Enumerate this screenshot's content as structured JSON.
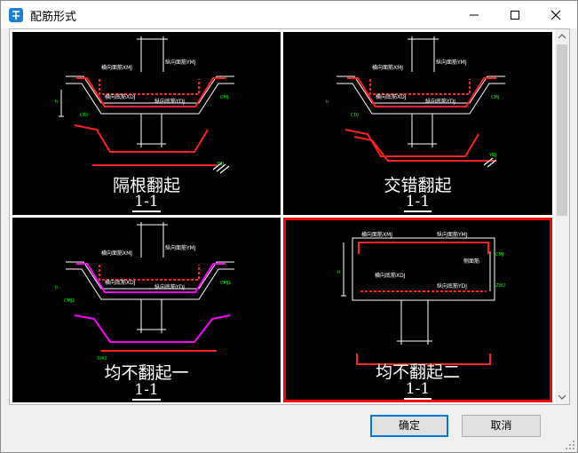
{
  "window": {
    "title": "配筋形式",
    "icons": {
      "app": "app-icon",
      "minimize": "minimize-icon",
      "maximize": "maximize-icon",
      "close": "close-icon"
    }
  },
  "options": [
    {
      "name": "隔根翻起",
      "section": "1-1",
      "selected": false,
      "labels": {
        "top_transverse": "横向面筋XMJ",
        "top_longitudinal": "纵向面筋YMJ",
        "bottom_transverse": "横向底筋XDJ",
        "bottom_longitudinal": "纵向底筋YDJ",
        "side": "CMJ",
        "side_alt": "CDJ",
        "vertical": "YBJ",
        "h": "h"
      }
    },
    {
      "name": "交错翻起",
      "section": "1-1",
      "selected": false,
      "labels": {
        "top_transverse": "横向面筋XMJ",
        "top_longitudinal": "纵向面筋YMJ",
        "bottom_transverse": "横向底筋XDJ",
        "bottom_longitudinal": "纵向底筋YDJ",
        "side": "CMJ",
        "side_alt": "CDJ",
        "vertical": "YBJ",
        "h": "h"
      }
    },
    {
      "name": "均不翻起一",
      "section": "1-1",
      "selected": false,
      "labels": {
        "top_transverse": "横向面筋XMJ",
        "top_longitudinal": "纵向面筋YMJ",
        "bottom_transverse": "横向底筋XDJ",
        "bottom_longitudinal": "纵向底筋YDJ",
        "side": "CMJ1",
        "side_alt": "CMJ2",
        "vertical": "XW2",
        "h": "h"
      }
    },
    {
      "name": "均不翻起二",
      "section": "1-1",
      "selected": true,
      "labels": {
        "top_transverse": "横向面筋XMJ",
        "top_longitudinal": "纵向面筋YMJ",
        "bottom_transverse": "横向底筋XDJ",
        "bottom_longitudinal": "纵向底筋YDJ",
        "side": "侧面筋",
        "side_alt": "CMJ",
        "vertical": "ZW2",
        "h": "h"
      }
    }
  ],
  "buttons": {
    "ok": "确定",
    "cancel": "取消"
  },
  "colors": {
    "selection": "#ff0000",
    "rebar": "#ff0000",
    "dim": "#00ff00",
    "line": "#ffffff",
    "alt_rebar": "#ff00ff"
  }
}
